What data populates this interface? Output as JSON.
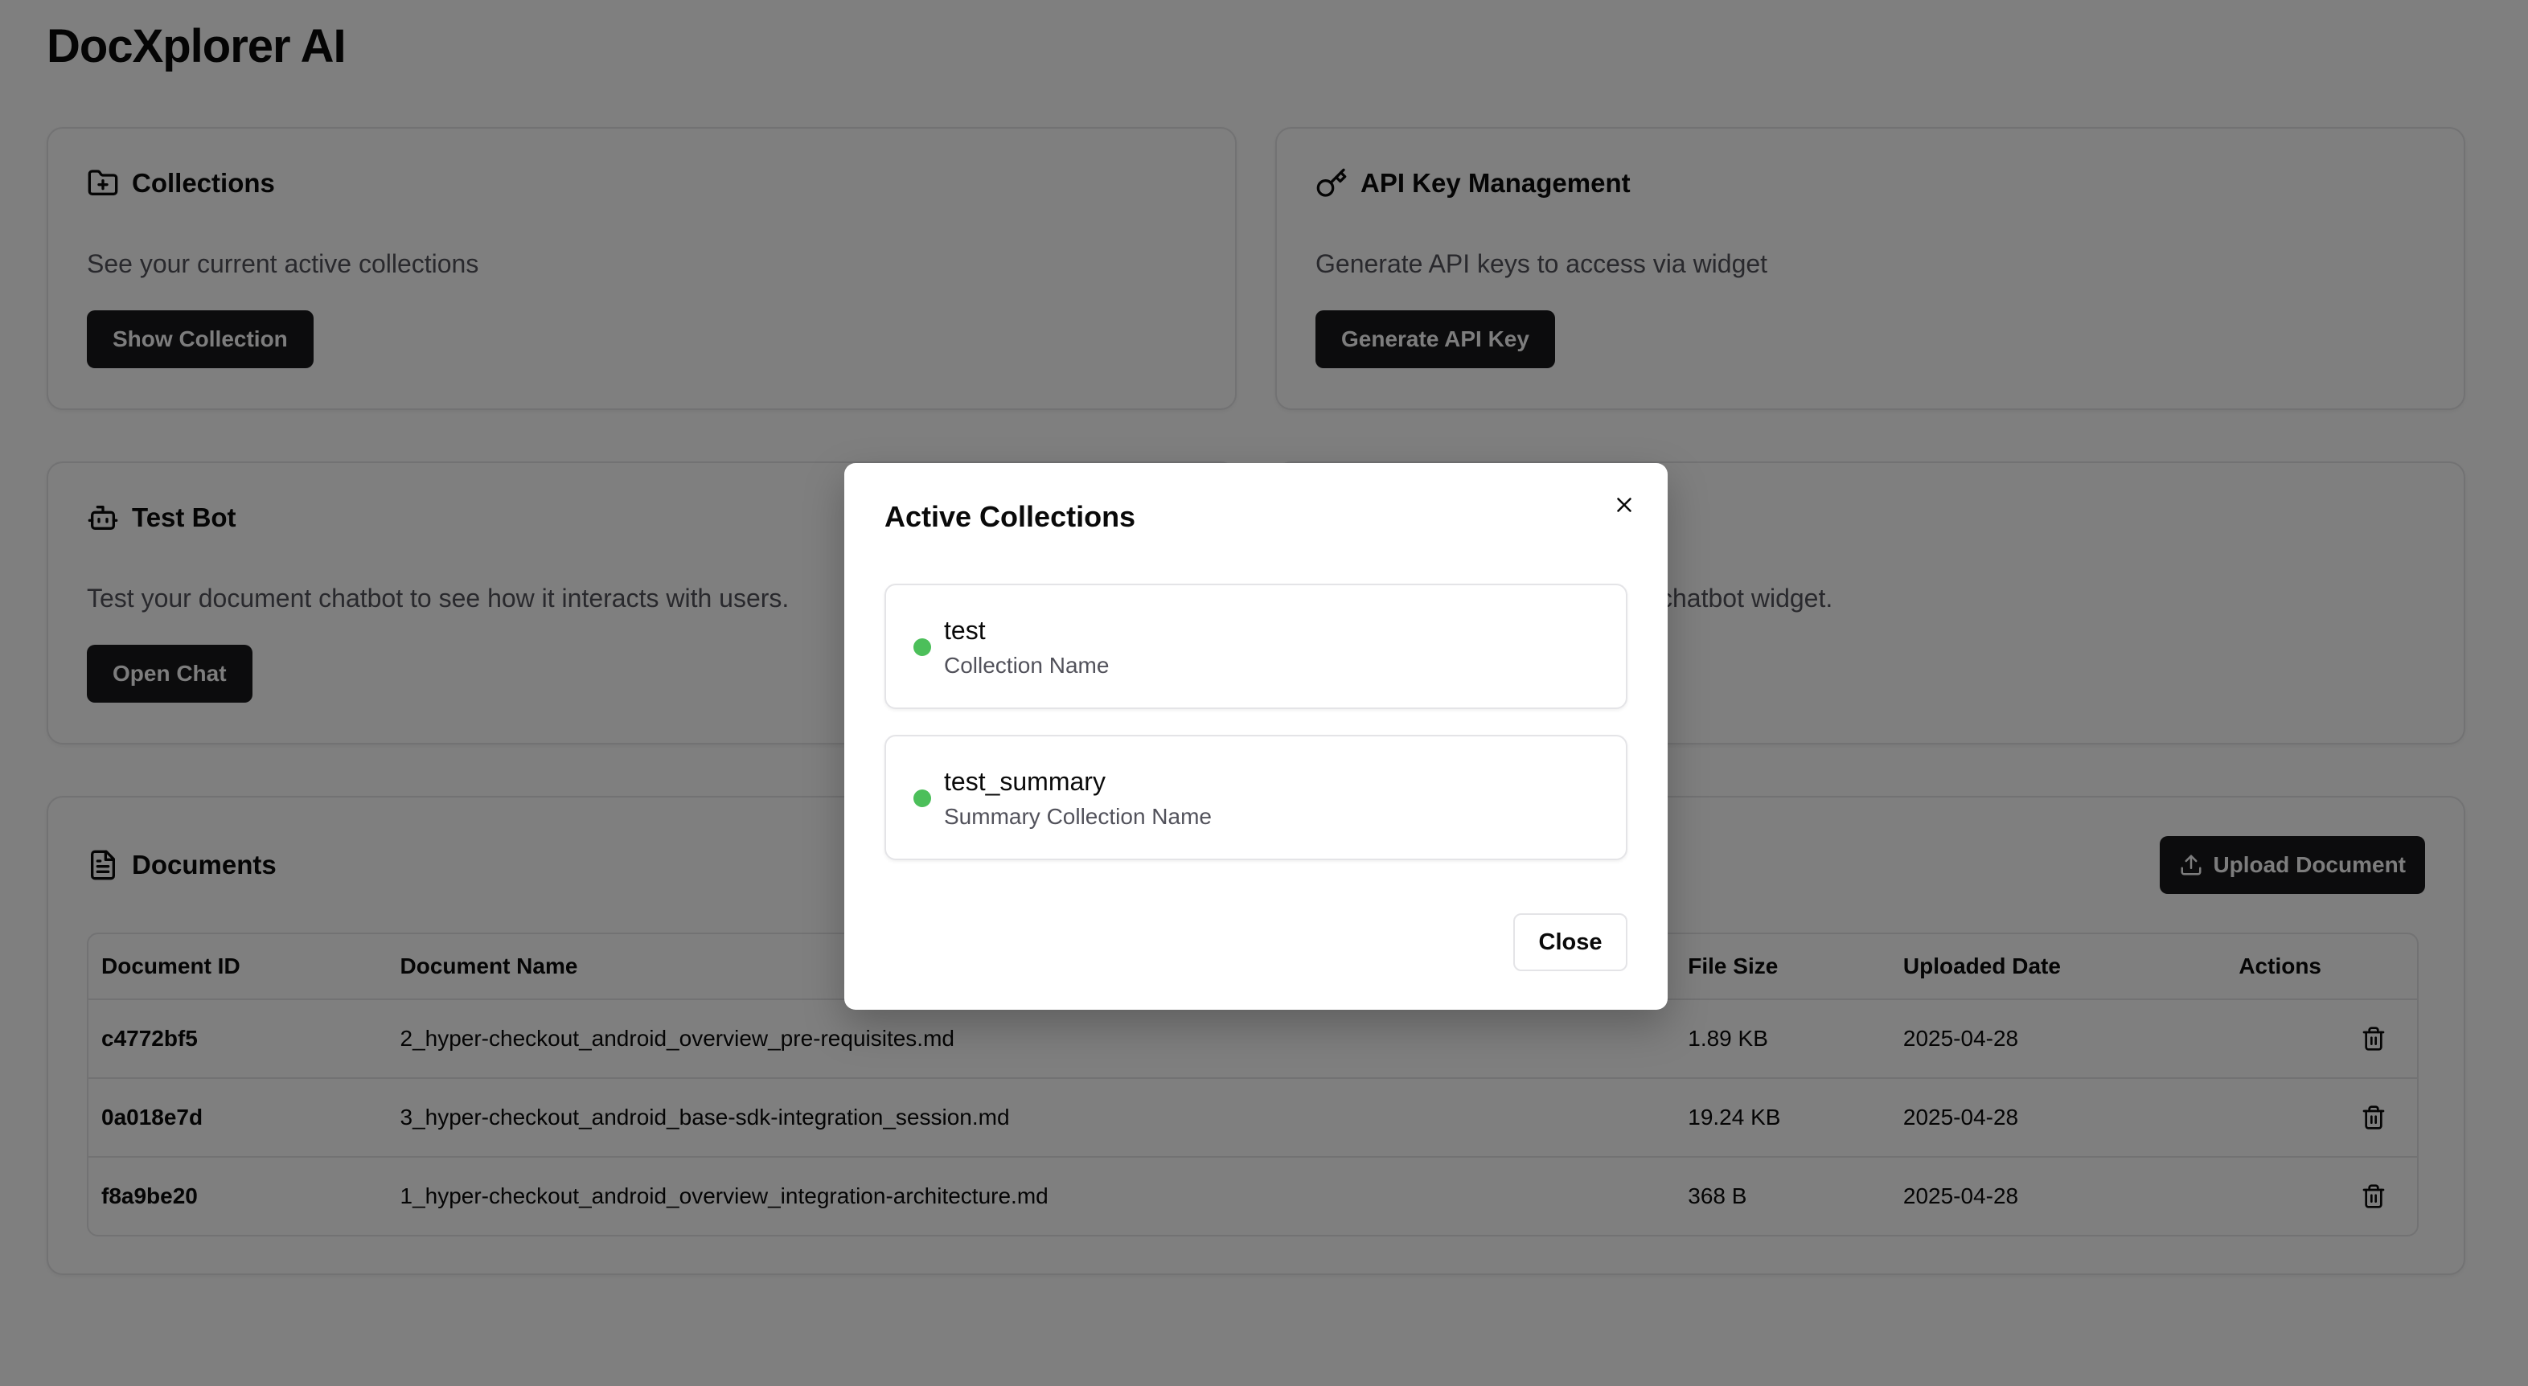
{
  "app": {
    "title": "DocXplorer AI"
  },
  "collections_card": {
    "title": "Collections",
    "description": "See your current active collections",
    "button": "Show Collection"
  },
  "api_card": {
    "title": "API Key Management",
    "description": "Generate API keys to access via widget",
    "button": "Generate API Key"
  },
  "testbot_card": {
    "title": "Test Bot",
    "description": "Test your document chatbot to see how it interacts with users.",
    "button": "Open Chat"
  },
  "widget_card": {
    "description_fragment": "chatbot widget."
  },
  "documents": {
    "title": "Documents",
    "upload_button": "Upload Document",
    "columns": [
      "Document ID",
      "Document Name",
      "File Size",
      "Uploaded Date",
      "Actions"
    ],
    "rows": [
      {
        "id": "c4772bf5",
        "name": "2_hyper-checkout_android_overview_pre-requisites.md",
        "size": "1.89 KB",
        "date": "2025-04-28"
      },
      {
        "id": "0a018e7d",
        "name": "3_hyper-checkout_android_base-sdk-integration_session.md",
        "size": "19.24 KB",
        "date": "2025-04-28"
      },
      {
        "id": "f8a9be20",
        "name": "1_hyper-checkout_android_overview_integration-architecture.md",
        "size": "368 B",
        "date": "2025-04-28"
      }
    ]
  },
  "modal": {
    "title": "Active Collections",
    "items": [
      {
        "name": "test",
        "label": "Collection Name"
      },
      {
        "name": "test_summary",
        "label": "Summary Collection Name"
      }
    ],
    "close_button": "Close"
  },
  "colors": {
    "accent_dark": "#18181b",
    "status_active": "#4cbf5a",
    "overlay": "rgba(0,0,0,0.5)"
  }
}
